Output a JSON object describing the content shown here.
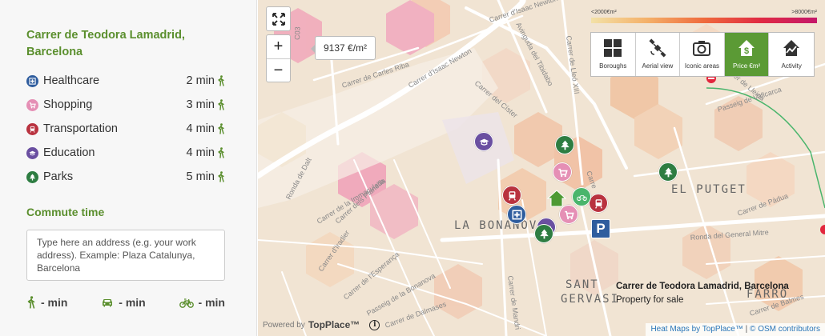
{
  "panel": {
    "address": "Carrer de Teodora Lamadrid, Barcelona",
    "amenities": [
      {
        "label": "Healthcare",
        "time": "2 min",
        "icon": "healthcare-icon",
        "color": "#2f5d9e"
      },
      {
        "label": "Shopping",
        "time": "3 min",
        "icon": "shopping-cart-icon",
        "color": "#e58fb5"
      },
      {
        "label": "Transportation",
        "time": "4 min",
        "icon": "train-icon",
        "color": "#b9323f"
      },
      {
        "label": "Education",
        "time": "4 min",
        "icon": "graduation-cap-icon",
        "color": "#6a4fa1"
      },
      {
        "label": "Parks",
        "time": "5 min",
        "icon": "tree-icon",
        "color": "#2e7d42"
      }
    ],
    "commute_title": "Commute time",
    "commute_placeholder": "Type here an address (e.g. your work address). Example: Plaza Catalunya, Barcelona",
    "modes": [
      {
        "mode": "walk",
        "value": "- min",
        "icon": "walking-icon"
      },
      {
        "mode": "car",
        "value": "- min",
        "icon": "car-icon"
      },
      {
        "mode": "bike",
        "value": "- min",
        "icon": "bicycle-icon"
      }
    ],
    "accent_color": "#5b8f2e"
  },
  "map": {
    "price_tooltip": "9137 €/m²",
    "legend_min": "<2000€m²",
    "legend_max": ">8000€m²",
    "layers": [
      {
        "label": "Boroughs",
        "icon": "grid-icon",
        "active": false
      },
      {
        "label": "Aerial view",
        "icon": "satellite-icon",
        "active": false
      },
      {
        "label": "Iconic areas",
        "icon": "camera-icon",
        "active": false
      },
      {
        "label": "Price €m²",
        "icon": "price-house-icon",
        "active": true
      },
      {
        "label": "Activity",
        "icon": "activity-house-icon",
        "active": false
      }
    ],
    "streets": {
      "isaac_newton_top": "Carrer d'Isaac Newton",
      "carles_riba": "Carrer de Carles Riba",
      "isaac_newton": "Carrer d'Isaac Newton",
      "tibidabo": "Avinguda del Tibidabo",
      "lleo_xiii": "Carrer de Lleó XIII",
      "cister": "Carrer del Císter",
      "c03": "C03",
      "ronda_dalt": "Ronda de Dalt",
      "immaculada": "Carrer de la Immaculada",
      "planella": "Carrer dels Planella",
      "iradier": "Carrer d'Iradier",
      "esperanca": "Carrer de l'Esperança",
      "bonanova_passeig": "Passeig de la Bonanova",
      "dalmases": "Carrer de Dalmases",
      "mandri": "Carrer de Mandri",
      "general_mitre": "Ronda del General Mitre",
      "padua": "Carrer de Pàdua",
      "vallcarca": "Passeig de Vallcarca",
      "balmes": "Carrer de Balmes",
      "lleida": "Carrer de Lleida",
      "cam": "Carre"
    },
    "hoods": {
      "bonanova": "LA BONANOVA",
      "putget": "EL PUTGET",
      "sant": "SANT",
      "gervasi": "GERVASI",
      "farro": "FARRÓ"
    },
    "info_title": "Carrer de Teodora Lamadrid, Barcelona",
    "info_sub": "Property for sale",
    "powered_label": "Powered by",
    "powered_brand": "TopPlace™",
    "attribution_heat": "Heat Maps by TopPlace™",
    "attribution_sep": "|",
    "attribution_osm": "© OSM contributors"
  }
}
